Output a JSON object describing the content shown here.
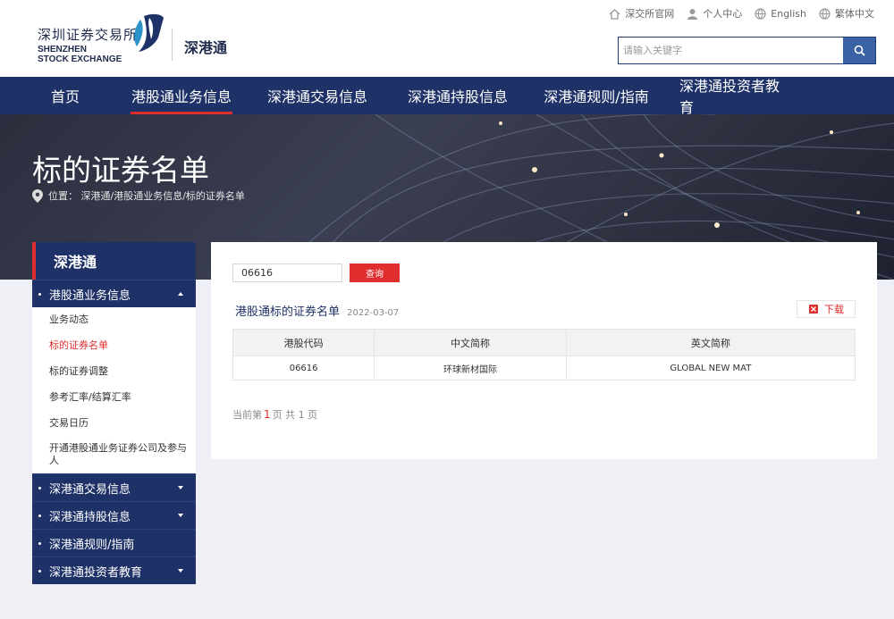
{
  "header": {
    "logo_cn": "深圳证券交易所",
    "logo_en_line1": "SHENZHEN",
    "logo_en_line2": "STOCK EXCHANGE",
    "brand": "深港通",
    "top_links": [
      {
        "label": "深交所官网",
        "icon": "home-icon"
      },
      {
        "label": "个人中心",
        "icon": "user-icon"
      },
      {
        "label": "English",
        "icon": "globe-icon"
      },
      {
        "label": "繁体中文",
        "icon": "globe-icon"
      }
    ],
    "search": {
      "placeholder": "请输入关键字",
      "value": ""
    }
  },
  "nav": {
    "items": [
      {
        "label": "首页",
        "active": false
      },
      {
        "label": "港股通业务信息",
        "active": true
      },
      {
        "label": "深港通交易信息",
        "active": false
      },
      {
        "label": "深港通持股信息",
        "active": false
      },
      {
        "label": "深港通规则/指南",
        "active": false
      },
      {
        "label": "深港通投资者教育",
        "active": false
      }
    ]
  },
  "banner": {
    "title": "标的证券名单",
    "breadcrumb": "位置：  深港通/港股通业务信息/标的证券名单"
  },
  "sidebar": {
    "title": "深港通",
    "sections": [
      {
        "label": "港股通业务信息",
        "expanded": true,
        "items": [
          "业务动态",
          "标的证券名单",
          "标的证券调整",
          "参考汇率/结算汇率",
          "交易日历",
          "开通港股通业务证券公司及参与人"
        ],
        "active_index": 1
      },
      {
        "label": "深港通交易信息",
        "expanded": false
      },
      {
        "label": "深港通持股信息",
        "expanded": false
      },
      {
        "label": "深港通规则/指南"
      },
      {
        "label": "深港通投资者教育",
        "expanded": false
      }
    ]
  },
  "main": {
    "query_value": "06616",
    "query_button": "查询",
    "list_title": "港股通标的证券名单",
    "list_date": "2022-03-07",
    "download_label": "下载",
    "table": {
      "headers": [
        "港股代码",
        "中文简称",
        "英文简称"
      ],
      "rows": [
        [
          "06616",
          "环球新材国际",
          "GLOBAL NEW MAT"
        ]
      ]
    },
    "pager": {
      "prefix": "当前第",
      "current": "1",
      "mid": "页   共",
      "total": "1",
      "suffix": "页"
    }
  },
  "colors": {
    "navy": "#1f3267",
    "accent_red": "#e02e2e",
    "search_blue": "#3c62a6"
  }
}
